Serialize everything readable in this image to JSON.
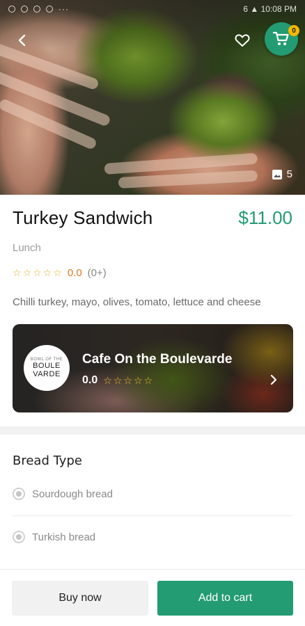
{
  "status_bar": {
    "time": "6  ▲  10:08 PM"
  },
  "hero": {
    "photo_count": "5"
  },
  "cart": {
    "badge_count": "0"
  },
  "product": {
    "name": "Turkey Sandwich",
    "price": "$11.00",
    "category": "Lunch",
    "rating_value": "0.0",
    "rating_count": "(0+)",
    "rating_stars": 0,
    "description": "Chilli turkey, mayo, olives, tomato, lettuce and cheese"
  },
  "restaurant": {
    "logo_small": "BOWL OF THE",
    "logo_line1": "BOULE",
    "logo_line2": "VARDE",
    "name": "Cafe On the Boulevarde",
    "rating_value": "0.0",
    "rating_stars": 0
  },
  "options": {
    "title": "Bread Type",
    "items": [
      {
        "label": "Sourdough bread",
        "selected": false
      },
      {
        "label": "Turkish bread",
        "selected": false
      }
    ]
  },
  "actions": {
    "buy_now": "Buy now",
    "add_to_cart": "Add to cart"
  },
  "colors": {
    "accent": "#239b73",
    "price": "#239b73",
    "rating": "#e07a1f",
    "star": "#e8b22e",
    "badge": "#f5b800"
  },
  "icons": {
    "back": "arrow-back-icon",
    "favorite": "heart-outline-icon",
    "cart": "shopping-cart-icon",
    "gallery": "image-icon",
    "chevron": "chevron-right-icon",
    "star": "star-outline-icon"
  }
}
